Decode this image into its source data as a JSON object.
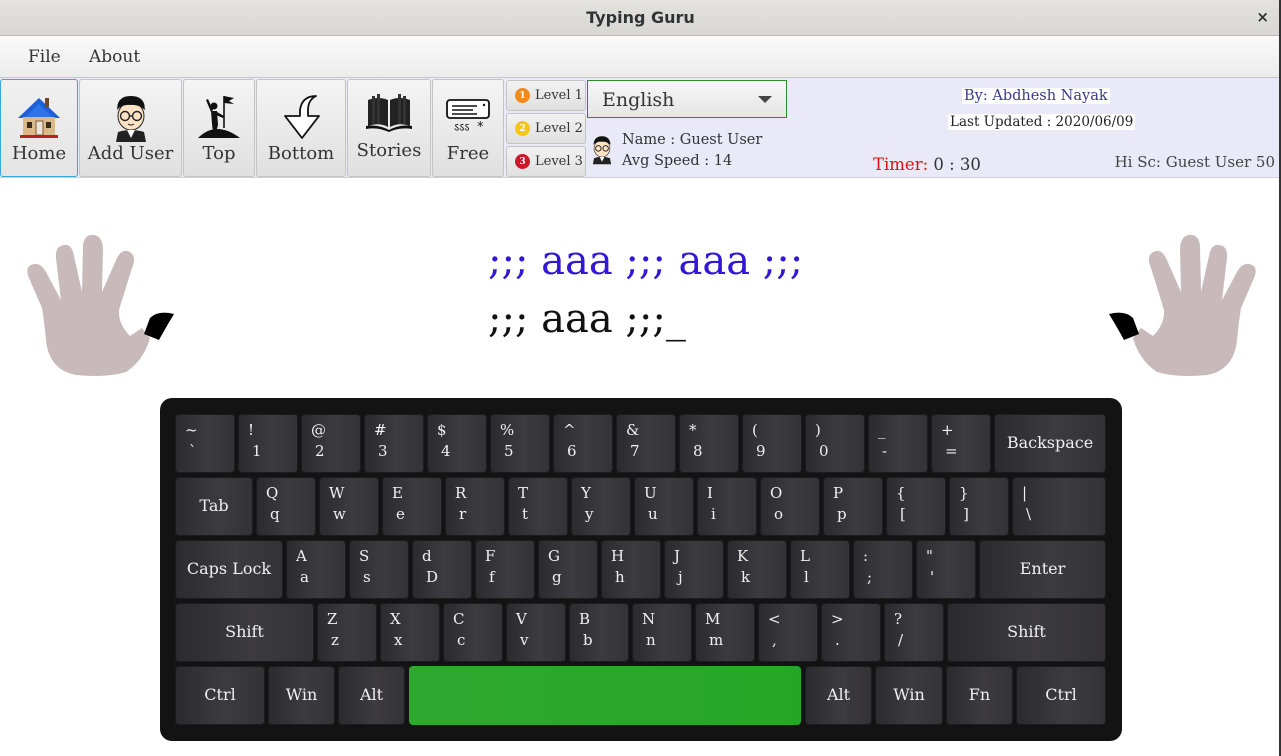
{
  "window": {
    "title": "Typing Guru",
    "close_label": "×"
  },
  "menu": {
    "items": [
      "File",
      "About"
    ]
  },
  "toolbar": {
    "buttons": [
      {
        "label": "Home",
        "icon": "house-icon",
        "active": true
      },
      {
        "label": "Add User",
        "icon": "user-avatar-icon"
      },
      {
        "label": "Top",
        "icon": "summit-flag-icon"
      },
      {
        "label": "Bottom",
        "icon": "down-arrow-icon"
      },
      {
        "label": "Stories",
        "icon": "book-icon"
      },
      {
        "label": "Free",
        "icon": "keyboard-icon"
      }
    ],
    "levels": [
      {
        "label": "Level 1",
        "badge": "1",
        "color": "#f08a1c"
      },
      {
        "label": "Level 2",
        "badge": "2",
        "color": "#f5c518"
      },
      {
        "label": "Level 3",
        "badge": "3",
        "color": "#d0172a"
      }
    ],
    "language": {
      "selected": "English"
    }
  },
  "user": {
    "name_line": "Name : Guest User",
    "speed_line": "Avg Speed : 14"
  },
  "credits": {
    "author": "By: Abdhesh Nayak",
    "updated": "Last Updated : 2020/06/09"
  },
  "timer": {
    "label": "Timer:",
    "value": " 0 : 30"
  },
  "high_score": {
    "text": "Hi Sc:  Guest User 50"
  },
  "practice": {
    "target": ";;; aaa ;;; aaa ;;;",
    "typed": ";;; aaa ;;;_"
  },
  "colors": {
    "target_text": "#3317d6",
    "timer_label": "#e01010",
    "space_highlight": "#2ba82b",
    "hand": "#c8b9ba",
    "finger_highlight": "#000000"
  },
  "hands": {
    "left": {
      "highlighted_finger": "thumb"
    },
    "right": {
      "highlighted_finger": "thumb"
    }
  },
  "keyboard": {
    "rows": [
      [
        {
          "t": "~",
          "b": "`"
        },
        {
          "t": "!",
          "b": "1"
        },
        {
          "t": "@",
          "b": "2"
        },
        {
          "t": "#",
          "b": "3"
        },
        {
          "t": "$",
          "b": "4"
        },
        {
          "t": "%",
          "b": "5"
        },
        {
          "t": "^",
          "b": "6"
        },
        {
          "t": "&",
          "b": "7"
        },
        {
          "t": "*",
          "b": "8"
        },
        {
          "t": "(",
          "b": "9"
        },
        {
          "t": ")",
          "b": "0"
        },
        {
          "t": "_",
          "b": "-"
        },
        {
          "t": "+",
          "b": "="
        },
        {
          "m": "Backspace"
        }
      ],
      [
        {
          "m": "Tab"
        },
        {
          "t": "Q",
          "b": "q"
        },
        {
          "t": "W",
          "b": "w"
        },
        {
          "t": "E",
          "b": "e"
        },
        {
          "t": "R",
          "b": "r"
        },
        {
          "t": "T",
          "b": "t"
        },
        {
          "t": "Y",
          "b": "y"
        },
        {
          "t": "U",
          "b": "u"
        },
        {
          "t": "I",
          "b": "i"
        },
        {
          "t": "O",
          "b": "o"
        },
        {
          "t": "P",
          "b": "p"
        },
        {
          "t": "{",
          "b": "["
        },
        {
          "t": "}",
          "b": "]"
        },
        {
          "t": "|",
          "b": "\\"
        }
      ],
      [
        {
          "m": "Caps Lock"
        },
        {
          "t": "A",
          "b": "a"
        },
        {
          "t": "S",
          "b": "s"
        },
        {
          "t": "d",
          "b": "D"
        },
        {
          "t": "F",
          "b": "f"
        },
        {
          "t": "G",
          "b": "g"
        },
        {
          "t": "H",
          "b": "h"
        },
        {
          "t": "J",
          "b": "j"
        },
        {
          "t": "K",
          "b": "k"
        },
        {
          "t": "L",
          "b": "l"
        },
        {
          "t": ":",
          "b": ";"
        },
        {
          "t": "\"",
          "b": "'"
        },
        {
          "m": "Enter"
        }
      ],
      [
        {
          "m": "Shift"
        },
        {
          "t": "Z",
          "b": "z"
        },
        {
          "t": "X",
          "b": "x"
        },
        {
          "t": "C",
          "b": "c"
        },
        {
          "t": "V",
          "b": "v"
        },
        {
          "t": "B",
          "b": "b"
        },
        {
          "t": "N",
          "b": "n"
        },
        {
          "t": "M",
          "b": "m"
        },
        {
          "t": "<",
          "b": ","
        },
        {
          "t": ">",
          "b": "."
        },
        {
          "t": "?",
          "b": "/"
        },
        {
          "m": "Shift"
        }
      ],
      [
        {
          "m": "Ctrl"
        },
        {
          "m": "Win"
        },
        {
          "m": "Alt"
        },
        {
          "m": "",
          "space": true
        },
        {
          "m": "Alt"
        },
        {
          "m": "Win"
        },
        {
          "m": "Fn"
        },
        {
          "m": "Ctrl"
        }
      ]
    ]
  }
}
